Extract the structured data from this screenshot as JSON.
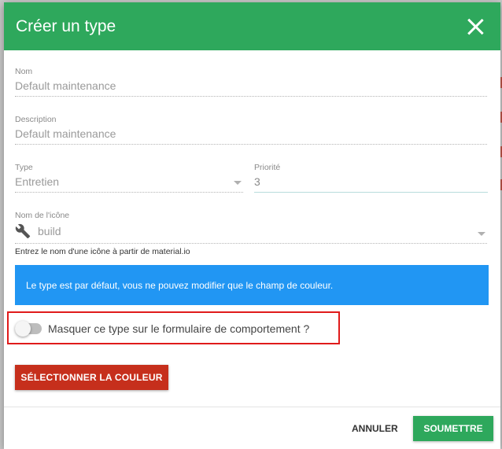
{
  "dialog": {
    "title": "Créer un type",
    "close_icon": "close-icon",
    "header_color": "#2ea85c"
  },
  "fields": {
    "nom": {
      "label": "Nom",
      "value": "Default maintenance"
    },
    "description": {
      "label": "Description",
      "value": "Default maintenance"
    },
    "type": {
      "label": "Type",
      "value": "Entretien"
    },
    "priorite": {
      "label": "Priorité",
      "value": "3"
    },
    "icone": {
      "label": "Nom de l'icône",
      "value": "build",
      "icon": "wrench-icon",
      "hint": "Entrez le nom d'une icône à partir de material.io"
    }
  },
  "info": {
    "text": "Le type est par défaut, vous ne pouvez modifier que le champ de couleur.",
    "color": "#2196f3"
  },
  "toggle": {
    "label": "Masquer ce type sur le formulaire de comportement ?",
    "checked": false
  },
  "buttons": {
    "color": "SÉLECTIONNER LA COULEUR",
    "color_bg": "#c62f1c",
    "cancel": "ANNULER",
    "submit": "SOUMETTRE"
  }
}
